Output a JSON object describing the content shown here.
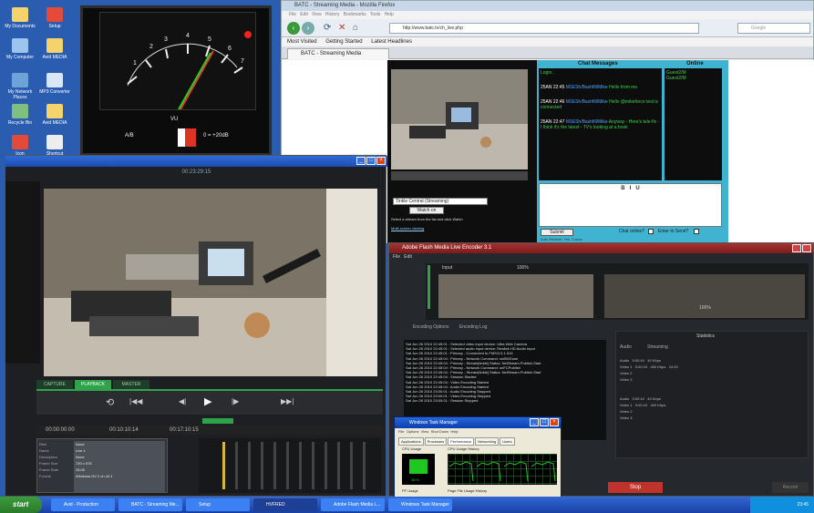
{
  "firefox": {
    "window_title": "BATC - Streaming Media - Mozilla Firefox",
    "url": "http://www.batc.tv/ch_live.php",
    "bookmarks": [
      "Most Visited",
      "Getting Started",
      "Latest Headlines"
    ],
    "tab_title": "BATC - Streaming Media",
    "stream_select_value": "Tinkle Central (Streaming)",
    "stream_button": "Watch on",
    "stream_hint": "Select a stream from the list and click Watch",
    "multi_screen_link": "Multi-screen viewing"
  },
  "chat": {
    "messages_header": "Chat Messages",
    "online_header": "Online",
    "messages": [
      {
        "text": "Login.."
      },
      {
        "time": "25AN 22:45",
        "user": "M1ESh/Bashfill/Mike",
        "text": "Hello from me"
      },
      {
        "time": "25AN 22:46",
        "user": "M1ESh/Bashfill/Mike",
        "text": "Hello @mikeforce test is connected"
      },
      {
        "time": "25AN 22:47",
        "user": "M1ESh/Bashfill/Mike",
        "text": "Anyway - Here's tele-fix - I think it's the latest - TV's looking at a book"
      }
    ],
    "online_users": [
      "Guest2/M",
      "Guest2/M"
    ],
    "format_buttons": [
      "B",
      "I",
      "U"
    ],
    "submit_label": "Submit",
    "chat_online_label": "Chat online?",
    "enter_to_send_label": "Enter to Send?",
    "footer_text": "Auto Refresh: Yes, 3 secs"
  },
  "encoder": {
    "timecode": "00:23:29:15",
    "tabs": [
      "CAPTURE",
      "PLAYBACK",
      "MASTER"
    ],
    "active_tab": "PLAYBACK",
    "time_left": "00:00:00:00",
    "time_right": "00:10:10:14",
    "duration": "00:17:10:15",
    "info_rows": [
      {
        "label": "Reel",
        "value": "None"
      },
      {
        "label": "Name",
        "value": "Live 1"
      },
      {
        "label": "Description",
        "value": "None"
      },
      {
        "label": "Frame Size",
        "value": "720 x 576"
      },
      {
        "label": "Frame Rate",
        "value": "25.00"
      },
      {
        "label": "Format",
        "value": "Windows DV 2 ch 44.1"
      }
    ]
  },
  "fmle": {
    "window_title": "Adobe Flash Media Live Encoder 3.1",
    "menu": [
      "File",
      "Edit"
    ],
    "zoom_left": "100%",
    "zoom_right": "100%",
    "log_tabs": [
      "Encoding Options",
      "Encoding Log"
    ],
    "stats_header": "Statistics",
    "stats_tabs": [
      "Audio",
      "Streaming"
    ],
    "log_lines": [
      "Sat Jun 26 2010 22:45:01 : Selected video input device: Ultra Web Camera",
      "Sat Jun 26 2010 22:45:01 : Selected audio input device: Realtek HD Audio Input",
      "Sat Jun 26 2010 22:45:01 : Primary - Connected to FMS/3.5.1.516",
      "Sat Jun 26 2010 22:45:04 : Primary - Network Command: onBWDone",
      "Sat Jun 26 2010 22:45:04 : Primary - Stream[tinkle] Status: NetStream.Publish.Start",
      "Sat Jun 26 2010 22:45:04 : Primary - Network Command: onFCPublish",
      "Sat Jun 26 2010 22:45:04 : Primary - Stream[tinkle] Status: NetStream.Publish.Start",
      "Sat Jun 26 2010 22:45:04 : Session Started",
      "Sat Jun 26 2010 22:45:04 : Video Encoding Started",
      "Sat Jun 26 2010 22:45:04 : Audio Encoding Started",
      "Sat Jun 26 2010 23:00:01 : Audio Encoding Stopped",
      "Sat Jun 26 2010 23:00:01 : Video Encoding Stopped",
      "Sat Jun 26 2010 23:00:01 : Session Stopped"
    ],
    "stop_label": "Stop",
    "dvr_label": "Record"
  },
  "taskmgr": {
    "window_title": "Windows Task Manager",
    "menu": [
      "File",
      "Options",
      "View",
      "Shut Down",
      "Help"
    ],
    "tabs": [
      "Applications",
      "Processes",
      "Performance",
      "Networking",
      "Users"
    ],
    "active_tab": "Performance",
    "cpu_usage_label": "CPU Usage",
    "cpu_history_label": "CPU Usage History",
    "cpu_value": "38 %",
    "pf_label": "PF Usage",
    "pf_history_label": "Page File Usage History"
  },
  "taskbar": {
    "start_label": "start",
    "buttons": [
      "Avid - Production",
      "BATC - Streaming Me...",
      "Setup",
      "HVFRED",
      "Adobe Flash Media L...",
      "Windows Task Manager"
    ],
    "clock": "23:45"
  },
  "vu_meter": {
    "label": "VU",
    "source_label": "A/B",
    "level": "0 = +20dB",
    "scale": [
      "1",
      "2",
      "3",
      "4",
      "5",
      "6",
      "7"
    ]
  },
  "desktop_icons": [
    "My Documents",
    "Setup",
    "My Computer",
    "Avid MEDIA",
    "My Network Places",
    "MP3 Convertor",
    "Recycle Bin",
    "Avid MEDIA",
    "Icon",
    "Shortcut"
  ]
}
